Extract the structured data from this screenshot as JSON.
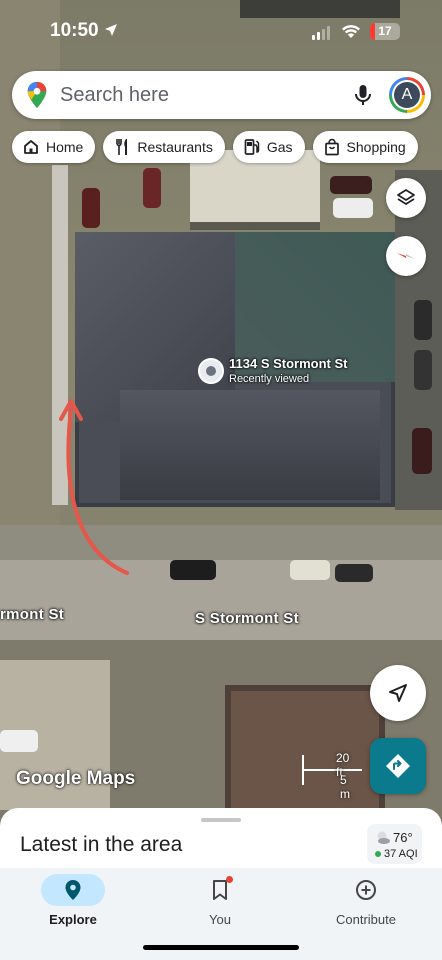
{
  "status_bar": {
    "time": "10:50",
    "battery": "17",
    "battery_pct": 17
  },
  "search": {
    "placeholder": "Search here",
    "avatar_initial": "A"
  },
  "chips": [
    {
      "label": "Home",
      "icon": "home-icon"
    },
    {
      "label": "Restaurants",
      "icon": "fork-knife-icon"
    },
    {
      "label": "Gas",
      "icon": "gas-pump-icon"
    },
    {
      "label": "Shopping",
      "icon": "shopping-bag-icon"
    }
  ],
  "map": {
    "place_name": "1134 S Stormont St",
    "place_sub": "Recently viewed",
    "street_main": "S Stormont St",
    "street_left": "rmont St",
    "logo": "Google Maps",
    "scale_ft": "20 ft",
    "scale_m": "5 m",
    "arrow_color": "#e4574a"
  },
  "sheet": {
    "title": "Latest in the area",
    "weather_temp": "76°",
    "weather_aqi": "37 AQI"
  },
  "nav": {
    "explore": "Explore",
    "you": "You",
    "contribute": "Contribute"
  },
  "colors": {
    "accent": "#0b7a8c",
    "active_nav_bg": "#c2e7ff",
    "alert": "#ea4335"
  }
}
